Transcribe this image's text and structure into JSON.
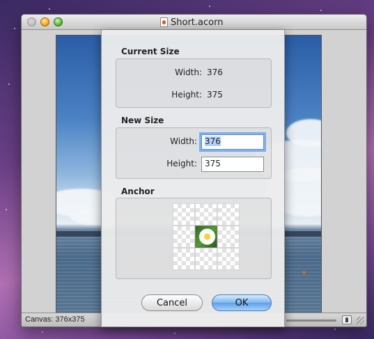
{
  "window": {
    "title": "Short.acorn",
    "status_text": "Canvas: 376x375"
  },
  "icons": {
    "close": "close-button-icon",
    "minimize": "minimize-button-icon",
    "maximize": "zoom-button-icon",
    "document": "acorn-document-icon",
    "resize": "resize-grip-icon",
    "person": "person-icon"
  },
  "sheet": {
    "current_size": {
      "heading": "Current Size",
      "width_label": "Width:",
      "width_value": "376",
      "height_label": "Height:",
      "height_value": "375"
    },
    "new_size": {
      "heading": "New Size",
      "width_label": "Width:",
      "width_value": "376",
      "height_label": "Height:",
      "height_value": "375"
    },
    "anchor": {
      "heading": "Anchor",
      "selected": "center"
    },
    "cancel_label": "Cancel",
    "ok_label": "OK"
  },
  "colors": {
    "accent": "#5e9fe6",
    "focus_ring": "#7eaef0"
  }
}
